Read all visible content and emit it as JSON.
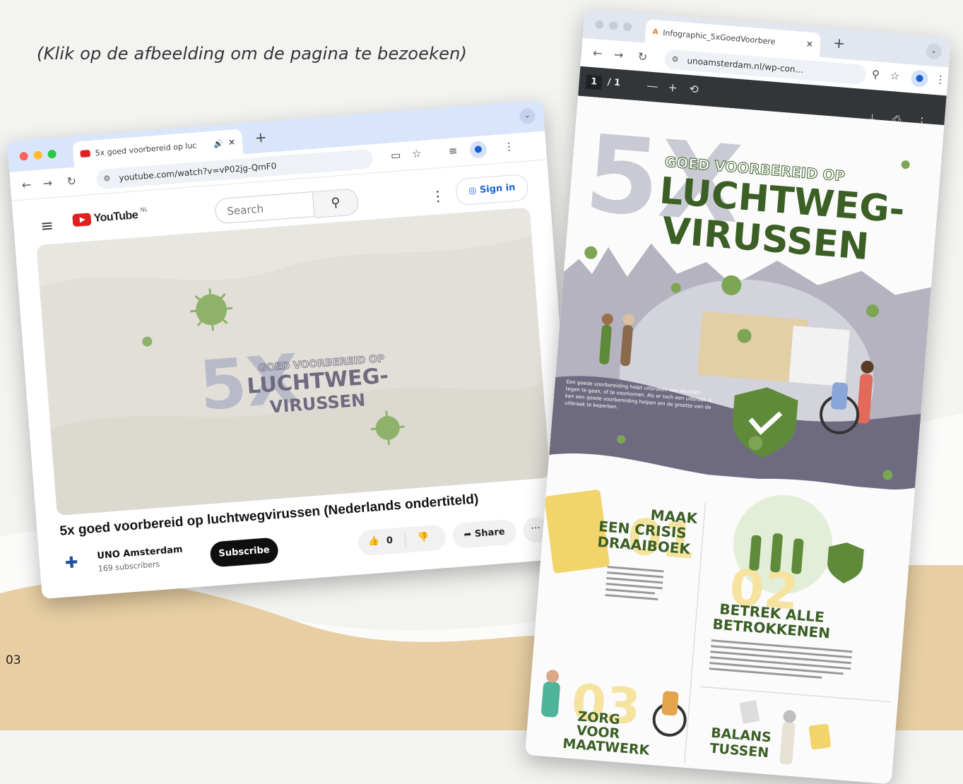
{
  "caption": "(Klik op de afbeelding om de pagina te bezoeken)",
  "page_number": "03",
  "youtube_browser": {
    "tab": {
      "title": "5x goed voorbereid op luc",
      "close": "✕",
      "new_tab": "+"
    },
    "address": {
      "url": "youtube.com/watch?v=vP02jg-QmF0"
    },
    "header": {
      "logo": "YouTube",
      "region": "NL",
      "search_placeholder": "Search",
      "sign_in": "Sign in"
    },
    "video": {
      "thumb_line1": "GOED VOORBEREID OP",
      "thumb_line2": "LUCHTWEG-",
      "thumb_line3": "VIRUSSEN",
      "thumb_5x": "5X",
      "title": "5x goed voorbereid op luchtwegvirussen (Nederlands ondertiteld)",
      "channel_name": "UNO Amsterdam",
      "channel_subs": "169 subscribers",
      "subscribe": "Subscribe",
      "likes": "0",
      "share": "Share",
      "more": "···"
    }
  },
  "pdf_browser": {
    "tab": {
      "title": "Infographic_5xGoedVoorbere",
      "close": "✕",
      "new_tab": "+"
    },
    "address": {
      "url": "unoamsterdam.nl/wp-con..."
    },
    "toolbar": {
      "page_current": "1",
      "page_total": "/ 1",
      "zoom_out": "—",
      "zoom_in": "+"
    },
    "infographic": {
      "big_5x": "5X",
      "line1": "GOED VOORBEREID OP",
      "line2": "LUCHTWEG-",
      "line3": "VIRUSSEN",
      "intro": "Een goede voorbereiding helpt uitbraken van virussen tegen te gaan, of te voorkomen. Als er toch een uitbraak is, kan een goede voorbereiding helpen om de grootte van de uitbraak te beperken.",
      "s1_num": "01",
      "s1_title_a": "MAAK",
      "s1_title_b": "EEN CRISIS",
      "s1_title_c": "DRAAIBOEK",
      "s2_num": "02",
      "s2_title_a": "BETREK ALLE",
      "s2_title_b": "BETROKKENEN",
      "s3_num": "03",
      "s3_title_a": "ZORG",
      "s3_title_b": "VOOR",
      "s3_title_c": "MAATWERK",
      "s4_title_a": "BALANS",
      "s4_title_b": "TUSSEN"
    }
  },
  "colors": {
    "green": "#5f8a3a",
    "dark_green": "#2f4f1f",
    "grey_5": "#b9bac7",
    "purple_grey": "#6e6b80",
    "sand": "#e8cfa3",
    "yellow": "#f2d56a"
  }
}
